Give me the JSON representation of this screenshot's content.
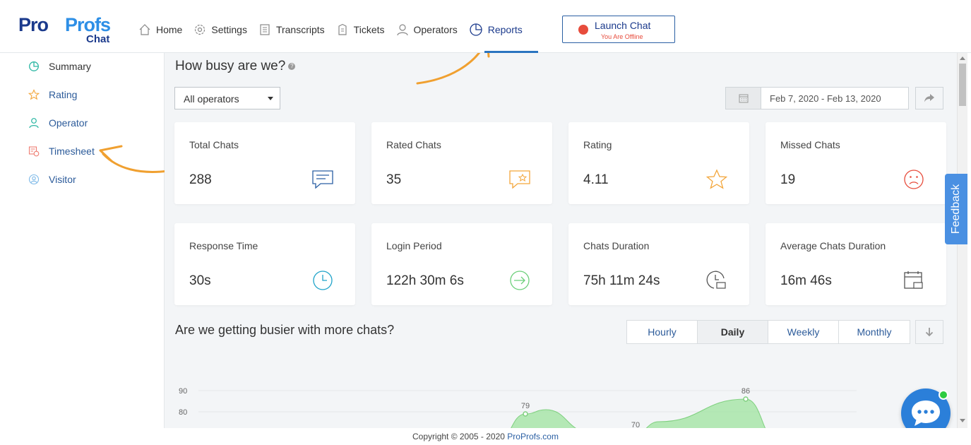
{
  "logo": {
    "part1": "Pro",
    "part2": "Profs",
    "sub": "Chat"
  },
  "nav": {
    "items": [
      {
        "label": "Home",
        "icon": "home-icon"
      },
      {
        "label": "Settings",
        "icon": "gear-icon"
      },
      {
        "label": "Transcripts",
        "icon": "document-icon"
      },
      {
        "label": "Tickets",
        "icon": "ticket-icon"
      },
      {
        "label": "Operators",
        "icon": "user-icon"
      },
      {
        "label": "Reports",
        "icon": "pie-chart-icon"
      }
    ],
    "active": "Reports"
  },
  "launch": {
    "label": "Launch Chat",
    "status": "You Are Offline"
  },
  "sidebar": {
    "items": [
      {
        "label": "Summary",
        "icon": "pie-chart-icon"
      },
      {
        "label": "Rating",
        "icon": "star-icon"
      },
      {
        "label": "Operator",
        "icon": "user-icon"
      },
      {
        "label": "Timesheet",
        "icon": "timesheet-icon"
      },
      {
        "label": "Visitor",
        "icon": "visitor-icon"
      }
    ]
  },
  "main": {
    "title": "How busy are we?",
    "help_glyph": "?",
    "operator_filter": "All operators",
    "date_range": "Feb 7, 2020 - Feb 13, 2020",
    "cards": [
      {
        "title": "Total Chats",
        "value": "288",
        "icon": "chat-icon"
      },
      {
        "title": "Rated Chats",
        "value": "35",
        "icon": "rated-chat-icon"
      },
      {
        "title": "Rating",
        "value": "4.11",
        "icon": "star-icon"
      },
      {
        "title": "Missed Chats",
        "value": "19",
        "icon": "sad-face-icon"
      },
      {
        "title": "Response Time",
        "value": "30s",
        "icon": "clock-icon"
      },
      {
        "title": "Login Period",
        "value": "122h 30m 6s",
        "icon": "login-icon"
      },
      {
        "title": "Chats Duration",
        "value": "75h 11m 24s",
        "icon": "clock-chat-icon"
      },
      {
        "title": "Average Chats Duration",
        "value": "16m 46s",
        "icon": "calendar-chat-icon"
      }
    ],
    "section2_title": "Are we getting busier with more chats?",
    "granularity": [
      "Hourly",
      "Daily",
      "Weekly",
      "Monthly"
    ],
    "granularity_selected": "Daily"
  },
  "chart_data": {
    "type": "area",
    "yticks": [
      "90",
      "80"
    ],
    "point_labels": [
      "79",
      "70",
      "86"
    ],
    "ylim": [
      70,
      90
    ],
    "color": "#9fe39f"
  },
  "footer": {
    "text": "Copyright © 2005 - 2020 ",
    "link": "ProProfs.com"
  },
  "feedback": "Feedback",
  "colors": {
    "brand_dark": "#1b3a8c",
    "brand_light": "#2e8fe6",
    "offline": "#e74c3c",
    "chart_fill": "#9fe39f"
  }
}
